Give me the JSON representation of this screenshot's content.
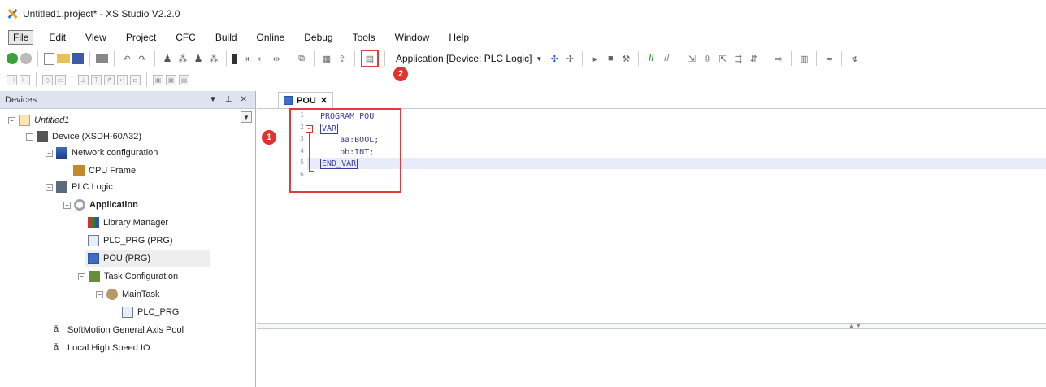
{
  "window": {
    "title": "Untitled1.project* - XS Studio V2.2.0"
  },
  "menu": [
    "File",
    "Edit",
    "View",
    "Project",
    "CFC",
    "Build",
    "Online",
    "Debug",
    "Tools",
    "Window",
    "Help"
  ],
  "toolbar": {
    "device_selector": "Application [Device: PLC Logic]"
  },
  "annotations": {
    "badge1": "1",
    "badge2": "2"
  },
  "devices_panel": {
    "title": "Devices",
    "tree": [
      {
        "label": "Untitled1",
        "style": "italic"
      },
      {
        "label": "Device (XSDH-60A32)"
      },
      {
        "label": "Network configuration"
      },
      {
        "label": "CPU Frame"
      },
      {
        "label": "PLC Logic"
      },
      {
        "label": "Application",
        "style": "bold"
      },
      {
        "label": "Library Manager"
      },
      {
        "label": "PLC_PRG (PRG)"
      },
      {
        "label": "POU (PRG)",
        "selected": true
      },
      {
        "label": "Task Configuration"
      },
      {
        "label": "MainTask"
      },
      {
        "label": "PLC_PRG"
      },
      {
        "label": "SoftMotion General Axis Pool"
      },
      {
        "label": "Local High Speed IO"
      }
    ]
  },
  "editor": {
    "tab_label": "POU",
    "line_numbers": [
      "1",
      "2",
      "3",
      "4",
      "5",
      "6"
    ],
    "code": {
      "line1": "PROGRAM POU",
      "line2": "VAR",
      "line3": "aa:BOOL;",
      "line4": "bb:INT;",
      "line5": "END_VAR"
    }
  }
}
